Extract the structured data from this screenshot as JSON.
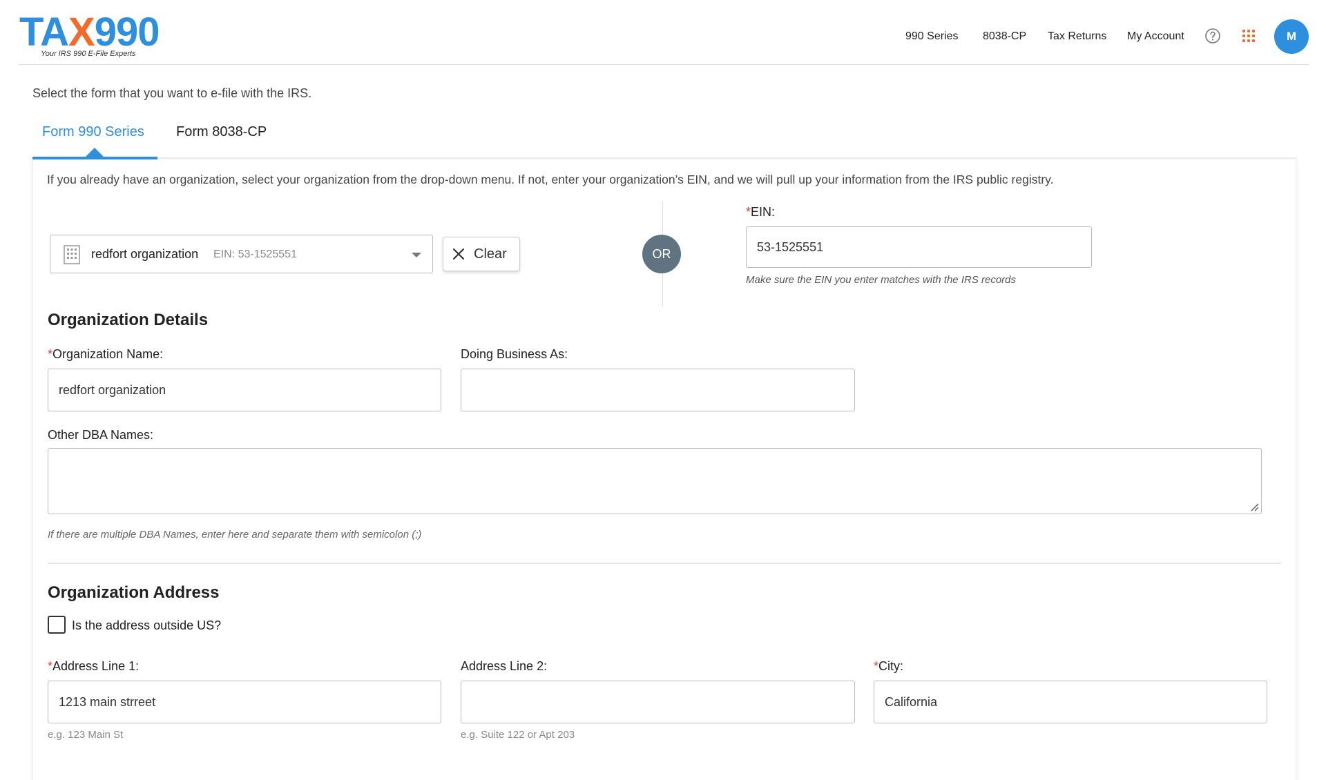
{
  "header": {
    "logo_text_a": "TA",
    "logo_text_x": "X",
    "logo_text_b": "990",
    "logo_tagline": "Your IRS 990 E-File Experts",
    "nav": [
      "990 Series",
      "8038-CP",
      "Tax Returns",
      "My Account"
    ],
    "avatar_initial": "M",
    "icons": [
      "help-icon",
      "apps-grid-icon"
    ]
  },
  "intro": "Select the form that you want to e-file with the IRS.",
  "tabs": [
    {
      "label": "Form 990 Series",
      "active": true
    },
    {
      "label": "Form 8038-CP",
      "active": false
    }
  ],
  "card": {
    "description": "If you already have an organization, select your organization from the drop-down menu. If not, enter your organization’s EIN, and we will pull up your information from the IRS public registry.",
    "org_select": {
      "name": "redfort organization",
      "ein": "EIN: 53-1525551"
    },
    "clear_label": "Clear",
    "or_label": "OR",
    "ein": {
      "required_mark": "*",
      "label": "EIN:",
      "value": "53-1525551",
      "hint": "Make sure the EIN you enter matches with the IRS records"
    }
  },
  "org_details": {
    "title": "Organization Details",
    "org_name": {
      "required_mark": "*",
      "label": "Organization Name:",
      "value": "redfort organization"
    },
    "dba": {
      "label": "Doing Business As:",
      "value": ""
    },
    "other_dba": {
      "label": "Other DBA Names:",
      "value": "",
      "hint": "If there are multiple DBA Names, enter here and separate them with semicolon (;)"
    }
  },
  "org_address": {
    "title": "Organization Address",
    "outside_us_label": "Is the address outside US?",
    "address1": {
      "required_mark": "*",
      "label": "Address Line 1:",
      "value": "1213 main strreet",
      "hint": "e.g. 123 Main St"
    },
    "address2": {
      "label": "Address Line 2:",
      "value": "",
      "hint": "e.g. Suite 122 or Apt 203"
    },
    "city": {
      "required_mark": "*",
      "label": "City:",
      "value": "California"
    }
  },
  "colors": {
    "brand": "#2d8fdd",
    "accent": "#f26b2a",
    "required": "#e53935",
    "or_badge": "#5f7480"
  }
}
